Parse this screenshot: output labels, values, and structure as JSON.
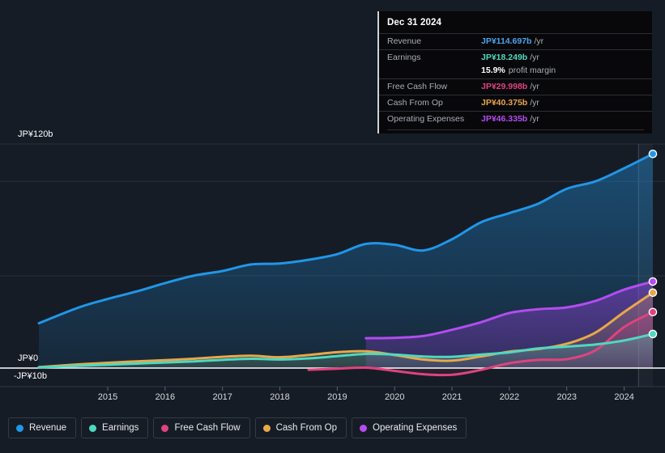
{
  "chart_data": {
    "type": "area",
    "title": "",
    "xlabel": "",
    "ylabel": "",
    "currency": "JP¥",
    "grid": true,
    "legend_position": "bottom-left",
    "ylim": [
      -10,
      130
    ],
    "y_ticks": [
      {
        "label": "JP¥120b",
        "value": 120
      },
      {
        "label": "JP¥0",
        "value": 0
      },
      {
        "label": "-JP¥10b",
        "value": -10
      }
    ],
    "x_ticks": [
      "2015",
      "2016",
      "2017",
      "2018",
      "2019",
      "2020",
      "2021",
      "2022",
      "2023",
      "2024"
    ],
    "x_range": [
      "2014.3",
      "2025.0"
    ],
    "hover_x": "2024.75",
    "series": [
      {
        "name": "Revenue",
        "color": "#2196e8",
        "x": [
          2014.3,
          2015,
          2015.5,
          2016,
          2016.5,
          2017,
          2017.5,
          2018,
          2018.5,
          2019,
          2019.5,
          2020,
          2020.5,
          2021,
          2021.5,
          2022,
          2022.5,
          2023,
          2023.5,
          2024,
          2024.5,
          2025
        ],
        "values": [
          24.0,
          32.5,
          37.0,
          41.0,
          45.5,
          49.5,
          52.0,
          55.5,
          56.0,
          58.0,
          61.0,
          66.5,
          66.0,
          63.0,
          69.0,
          78.0,
          83.0,
          88.0,
          96.0,
          100.0,
          107.0,
          114.697
        ],
        "end_value": 114.697
      },
      {
        "name": "Earnings",
        "color": "#4fd8c0",
        "x": [
          2014.3,
          2015,
          2015.5,
          2016,
          2016.5,
          2017,
          2017.5,
          2018,
          2018.5,
          2019,
          2019.5,
          2020,
          2020.5,
          2021,
          2021.5,
          2022,
          2022.5,
          2023,
          2023.5,
          2024,
          2024.5,
          2025
        ],
        "values": [
          0.3,
          1.2,
          1.8,
          2.4,
          3.0,
          3.6,
          4.4,
          5.0,
          4.6,
          5.2,
          6.4,
          7.6,
          7.2,
          6.2,
          6.0,
          7.2,
          8.4,
          10.5,
          11.5,
          12.6,
          14.8,
          18.249
        ],
        "end_value": 18.249
      },
      {
        "name": "Free Cash Flow",
        "color": "#e0437f",
        "x": [
          2019,
          2019.5,
          2020,
          2020.5,
          2021,
          2021.5,
          2022,
          2022.5,
          2023,
          2023.5,
          2024,
          2024.5,
          2025
        ],
        "values": [
          -0.9,
          -0.3,
          0.2,
          -1.5,
          -3.3,
          -3.6,
          -1.0,
          2.6,
          4.4,
          4.8,
          9.5,
          22.0,
          29.998
        ],
        "end_value": 29.998
      },
      {
        "name": "Cash From Op",
        "color": "#e8a84a",
        "x": [
          2014.3,
          2015,
          2015.5,
          2016,
          2016.5,
          2017,
          2017.5,
          2018,
          2018.5,
          2019,
          2019.5,
          2020,
          2020.5,
          2021,
          2021.5,
          2022,
          2022.5,
          2023,
          2023.5,
          2024,
          2024.5,
          2025
        ],
        "values": [
          0.5,
          2.0,
          2.8,
          3.6,
          4.2,
          5.0,
          6.0,
          6.6,
          5.8,
          7.0,
          8.5,
          9.0,
          7.0,
          4.6,
          4.0,
          6.2,
          8.8,
          10.2,
          13.0,
          19.0,
          30.0,
          40.375
        ],
        "end_value": 40.375
      },
      {
        "name": "Operating Expenses",
        "color": "#b44cf0",
        "x": [
          2020,
          2020.5,
          2021,
          2021.5,
          2022,
          2022.5,
          2023,
          2023.5,
          2024,
          2024.5,
          2025
        ],
        "values": [
          16.0,
          16.2,
          17.2,
          20.5,
          24.5,
          29.5,
          31.5,
          32.5,
          36.0,
          42.0,
          46.335
        ],
        "end_value": 46.335
      }
    ]
  },
  "tooltip": {
    "date": "Dec 31 2024",
    "unit": "/yr",
    "rows": [
      {
        "label": "Revenue",
        "value": "JP¥114.697b",
        "color": "#4ea3f0"
      },
      {
        "label": "Earnings",
        "value": "JP¥18.249b",
        "color": "#4fd8c0"
      },
      {
        "label": "Free Cash Flow",
        "value": "JP¥29.998b",
        "color": "#e0437f"
      },
      {
        "label": "Cash From Op",
        "value": "JP¥40.375b",
        "color": "#e8a84a"
      },
      {
        "label": "Operating Expenses",
        "value": "JP¥46.335b",
        "color": "#b44cf0"
      }
    ],
    "profit_margin_value": "15.9%",
    "profit_margin_label": "profit margin"
  },
  "legend": {
    "items": [
      {
        "label": "Revenue",
        "color": "#2196e8"
      },
      {
        "label": "Earnings",
        "color": "#4fd8c0"
      },
      {
        "label": "Free Cash Flow",
        "color": "#e0437f"
      },
      {
        "label": "Cash From Op",
        "color": "#e8a84a"
      },
      {
        "label": "Operating Expenses",
        "color": "#b44cf0"
      }
    ]
  }
}
